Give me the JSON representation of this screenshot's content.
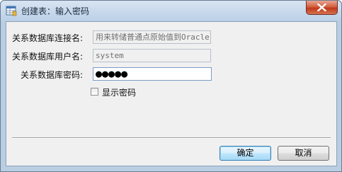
{
  "window": {
    "title": "创建表：输入密码"
  },
  "form": {
    "connection_name_label": "关系数据库连接名:",
    "connection_name_value": "用来转储普通点原始值到Oracle",
    "username_label": "关系数据库用户名:",
    "username_value": "system",
    "password_label": "关系数据库密码:",
    "password_masked": "●●●●●",
    "show_password_label": "显示密码",
    "show_password_checked": false
  },
  "buttons": {
    "ok_label": "确定",
    "cancel_label": "取消"
  },
  "icons": {
    "title_icon": "table-window-icon",
    "close_icon": "close-icon"
  },
  "colors": {
    "close_button": "#c83d1f",
    "default_button_border": "#3c7fb1"
  }
}
